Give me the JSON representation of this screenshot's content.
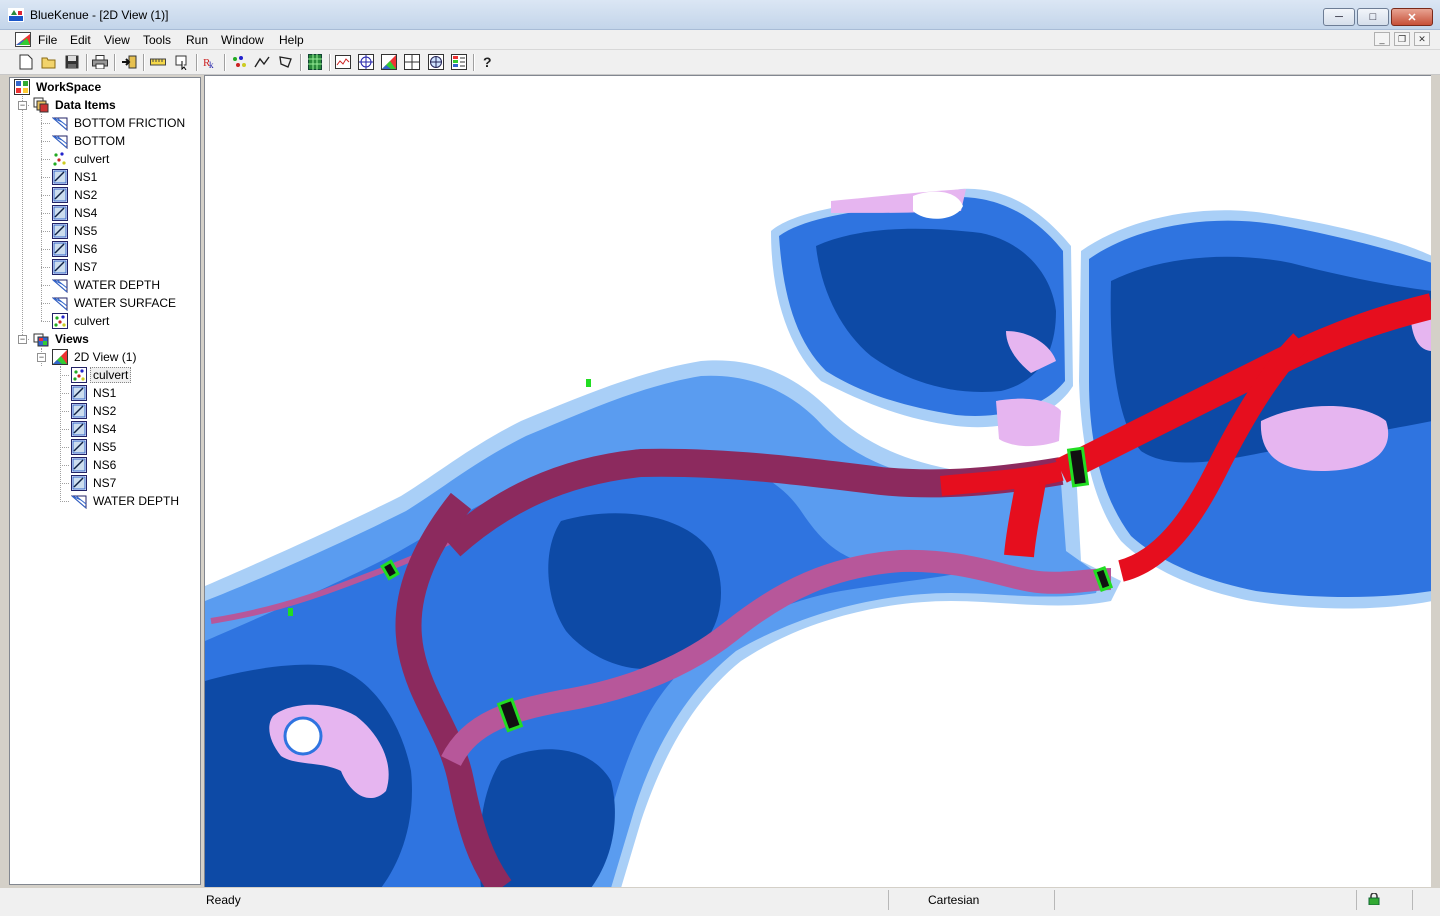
{
  "window": {
    "title": "BlueKenue - [2D View (1)]",
    "minimize": "─",
    "maximize": "□",
    "close": "✕"
  },
  "menu": {
    "items": [
      "File",
      "Edit",
      "View",
      "Tools",
      "Run",
      "Window",
      "Help"
    ],
    "mdi_min": "_",
    "mdi_restore": "❐",
    "mdi_close": "✕"
  },
  "toolbar": {
    "icons": [
      "new-icon",
      "open-icon",
      "save-icon",
      "print-icon",
      "import-icon",
      "ruler-icon",
      "pointer-icon",
      "text-icon",
      "points-icon",
      "line-icon",
      "polygon-icon",
      "grid-icon",
      "profile-icon",
      "target-icon",
      "colormap-icon",
      "layout-icon",
      "globe-icon",
      "legend-icon",
      "help-icon"
    ]
  },
  "tree": {
    "workspace": "WorkSpace",
    "data_items": {
      "label": "Data Items",
      "items": [
        "BOTTOM FRICTION",
        "BOTTOM",
        "culvert",
        "NS1",
        "NS2",
        "NS4",
        "NS5",
        "NS6",
        "NS7",
        "WATER DEPTH",
        "WATER SURFACE",
        "culvert"
      ]
    },
    "views": {
      "label": "Views",
      "view_label": "2D View (1)",
      "items": [
        "culvert",
        "NS1",
        "NS2",
        "NS4",
        "NS5",
        "NS6",
        "NS7",
        "WATER DEPTH"
      ]
    }
  },
  "status": {
    "left": "Ready",
    "coords": "Cartesian"
  },
  "colors": {
    "deep": "#0d4aa6",
    "mid": "#2f74e0",
    "shallow": "#5a9cf0",
    "edge": "#a9cff7",
    "channel": "#8c2a5e",
    "channel_light": "#b7579a",
    "fast": "#e60e1e",
    "shoal": "#e6b5f0",
    "culvert": "#22dd22"
  }
}
